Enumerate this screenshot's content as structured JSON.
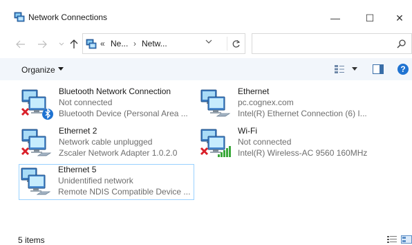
{
  "window": {
    "title": "Network Connections",
    "minimize_glyph": "—",
    "maximize_glyph": "☐",
    "close_glyph": "✕"
  },
  "address": {
    "overflow": "«",
    "crumbs": [
      "Ne...",
      "›",
      "Netw..."
    ],
    "search_placeholder": ""
  },
  "toolbar": {
    "organize_label": "Organize",
    "help_label": "?"
  },
  "items": [
    {
      "name": "Bluetooth Network Connection",
      "status": "Not connected",
      "device": "Bluetooth Device (Personal Area ...",
      "icon": "bluetooth-adapter-icon",
      "badge": "red-x"
    },
    {
      "name": "Ethernet",
      "status": "pc.cognex.com",
      "device": "Intel(R) Ethernet Connection (6) I...",
      "icon": "ethernet-adapter-icon",
      "badge": "none"
    },
    {
      "name": "Ethernet 2",
      "status": "Network cable unplugged",
      "device": "Zscaler Network Adapter 1.0.2.0",
      "icon": "ethernet-adapter-icon",
      "badge": "red-x"
    },
    {
      "name": "Wi-Fi",
      "status": "Not connected",
      "device": "Intel(R) Wireless-AC 9560 160MHz",
      "icon": "wifi-adapter-icon",
      "badge": "red-x"
    },
    {
      "name": "Ethernet 5",
      "status": "Unidentified network",
      "device": "Remote NDIS Compatible Device ...",
      "icon": "ethernet-adapter-icon",
      "badge": "none",
      "selected": true
    }
  ],
  "status": {
    "item_count": "5 items"
  },
  "colors": {
    "accent": "#1f73d1",
    "selection_border": "#99d1ff",
    "command_bar": "#f2f6fb",
    "error_red": "#d9202a",
    "wifi_green": "#3aa83a"
  }
}
